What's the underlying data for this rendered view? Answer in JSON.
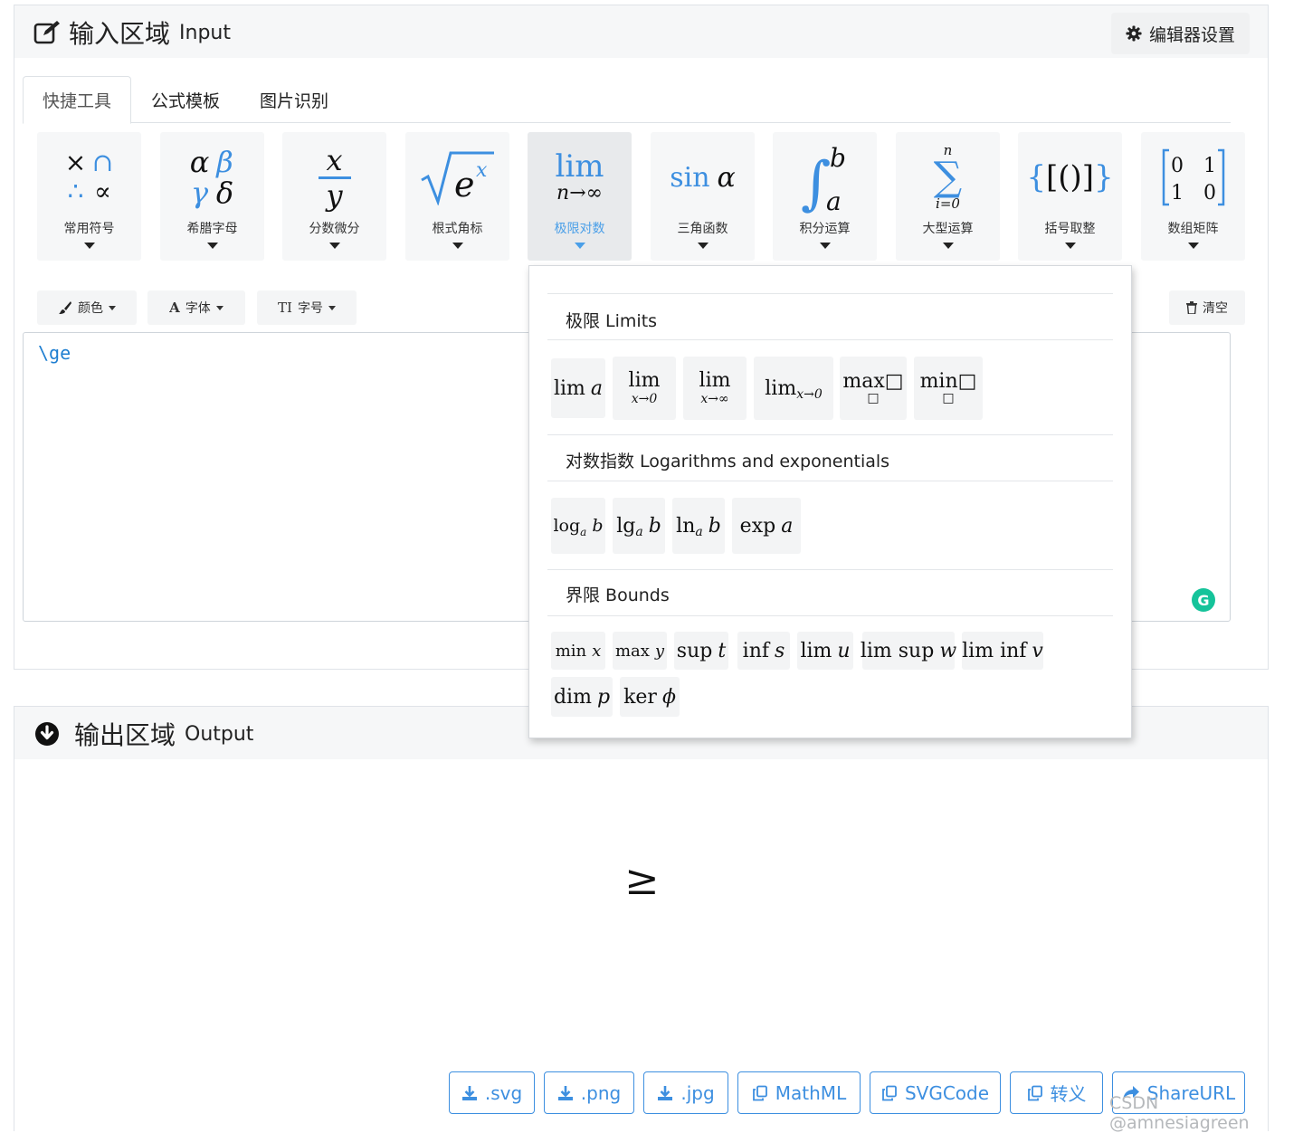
{
  "input_panel": {
    "title_zh": "输入区域",
    "title_en": "Input",
    "settings_label": "编辑器设置"
  },
  "tabs": [
    {
      "label": "快捷工具",
      "active": true
    },
    {
      "label": "公式模板",
      "active": false
    },
    {
      "label": "图片识别",
      "active": false
    }
  ],
  "tools": [
    {
      "label": "常用符号",
      "icon": "common-symbols-icon"
    },
    {
      "label": "希腊字母",
      "icon": "greek-letters-icon"
    },
    {
      "label": "分数微分",
      "icon": "fraction-icon"
    },
    {
      "label": "根式角标",
      "icon": "radical-icon"
    },
    {
      "label": "极限对数",
      "icon": "limit-icon",
      "active": true
    },
    {
      "label": "三角函数",
      "icon": "trig-icon"
    },
    {
      "label": "积分运算",
      "icon": "integral-icon"
    },
    {
      "label": "大型运算",
      "icon": "sum-icon"
    },
    {
      "label": "括号取整",
      "icon": "brackets-icon"
    },
    {
      "label": "数组矩阵",
      "icon": "matrix-icon"
    }
  ],
  "format_bar": {
    "color_label": "颜色",
    "font_label": "字体",
    "size_label": "字号",
    "clear_label": "清空"
  },
  "editor": {
    "value": "\\ge"
  },
  "dropdown": {
    "section_limits": "极限 Limits",
    "section_logs": "对数指数 Logarithms and exponentials",
    "section_bounds": "界限 Bounds"
  },
  "output_panel": {
    "title_zh": "输出区域",
    "title_en": "Output",
    "rendered": "≥"
  },
  "export_buttons": [
    {
      "label": ".svg",
      "icon": "download-icon"
    },
    {
      "label": ".png",
      "icon": "download-icon"
    },
    {
      "label": ".jpg",
      "icon": "download-icon"
    },
    {
      "label": "MathML",
      "icon": "copy-icon"
    },
    {
      "label": "SVGCode",
      "icon": "copy-icon"
    },
    {
      "label": "转义",
      "icon": "copy-icon"
    },
    {
      "label": "ShareURL",
      "icon": "share-icon"
    }
  ],
  "watermark": "CSDN @amnesiagreen",
  "colors": {
    "accent": "#3d8fe0",
    "panel_header": "#f6f7f8",
    "grammarly": "#15c39a"
  }
}
